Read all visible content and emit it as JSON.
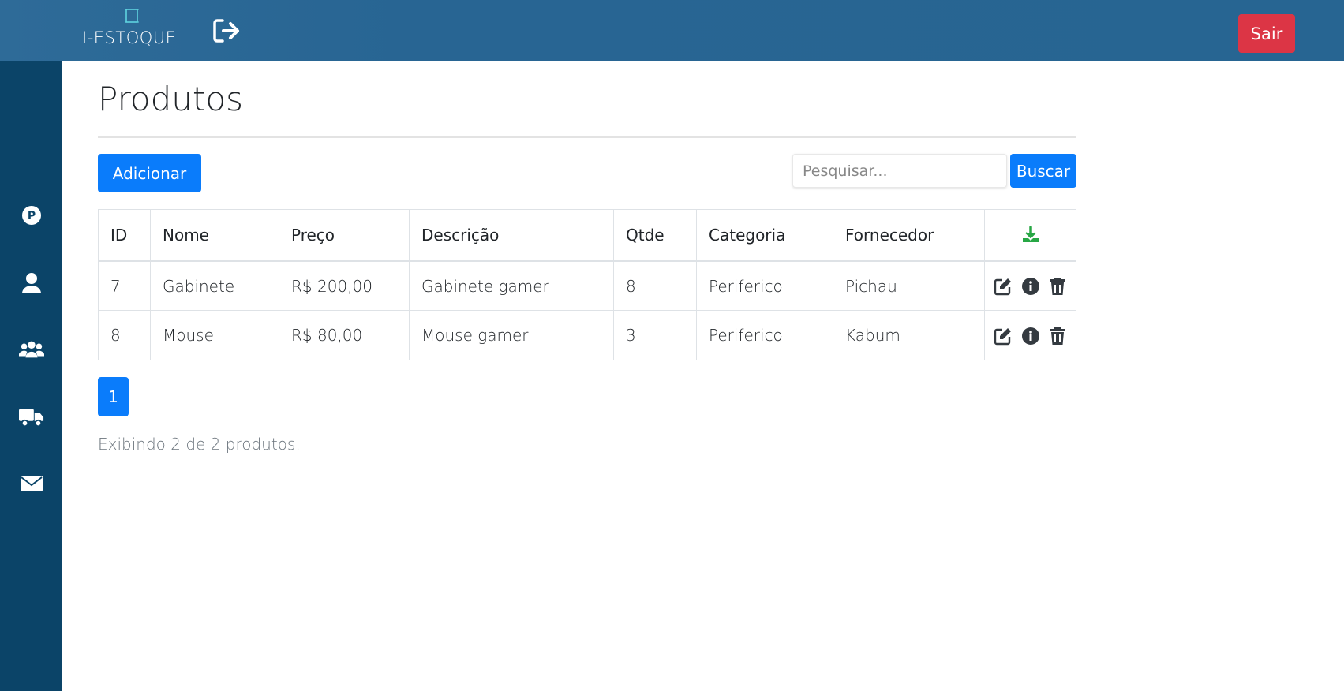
{
  "app": {
    "logo_text": "I-ESTOQUE",
    "logout_label": "Sair"
  },
  "sidebar": {
    "items": [
      {
        "icon": "parking-icon"
      },
      {
        "icon": "user-icon"
      },
      {
        "icon": "users-icon"
      },
      {
        "icon": "truck-icon"
      },
      {
        "icon": "envelope-icon"
      }
    ]
  },
  "page": {
    "title": "Produtos",
    "add_label": "Adicionar",
    "search_placeholder": "Pesquisar...",
    "search_label": "Buscar"
  },
  "table": {
    "headers": [
      "ID",
      "Nome",
      "Preço",
      "Descrição",
      "Qtde",
      "Categoria",
      "Fornecedor"
    ],
    "download_icon": "download-icon",
    "rows": [
      [
        "7",
        "Gabinete",
        "R$ 200,00",
        "Gabinete gamer",
        "8",
        "Periferico",
        "Pichau"
      ],
      [
        "8",
        "Mouse",
        "R$ 80,00",
        "Mouse gamer",
        "3",
        "Periferico",
        "Kabum"
      ]
    ]
  },
  "pagination": {
    "current": "1"
  },
  "footer": {
    "info": "Exibindo 2 de 2 produtos."
  },
  "colors": {
    "topbar": "#286593",
    "sidebar": "#0b4468",
    "primary": "#0a7cfb",
    "danger": "#dc3545",
    "download": "#28a745"
  }
}
